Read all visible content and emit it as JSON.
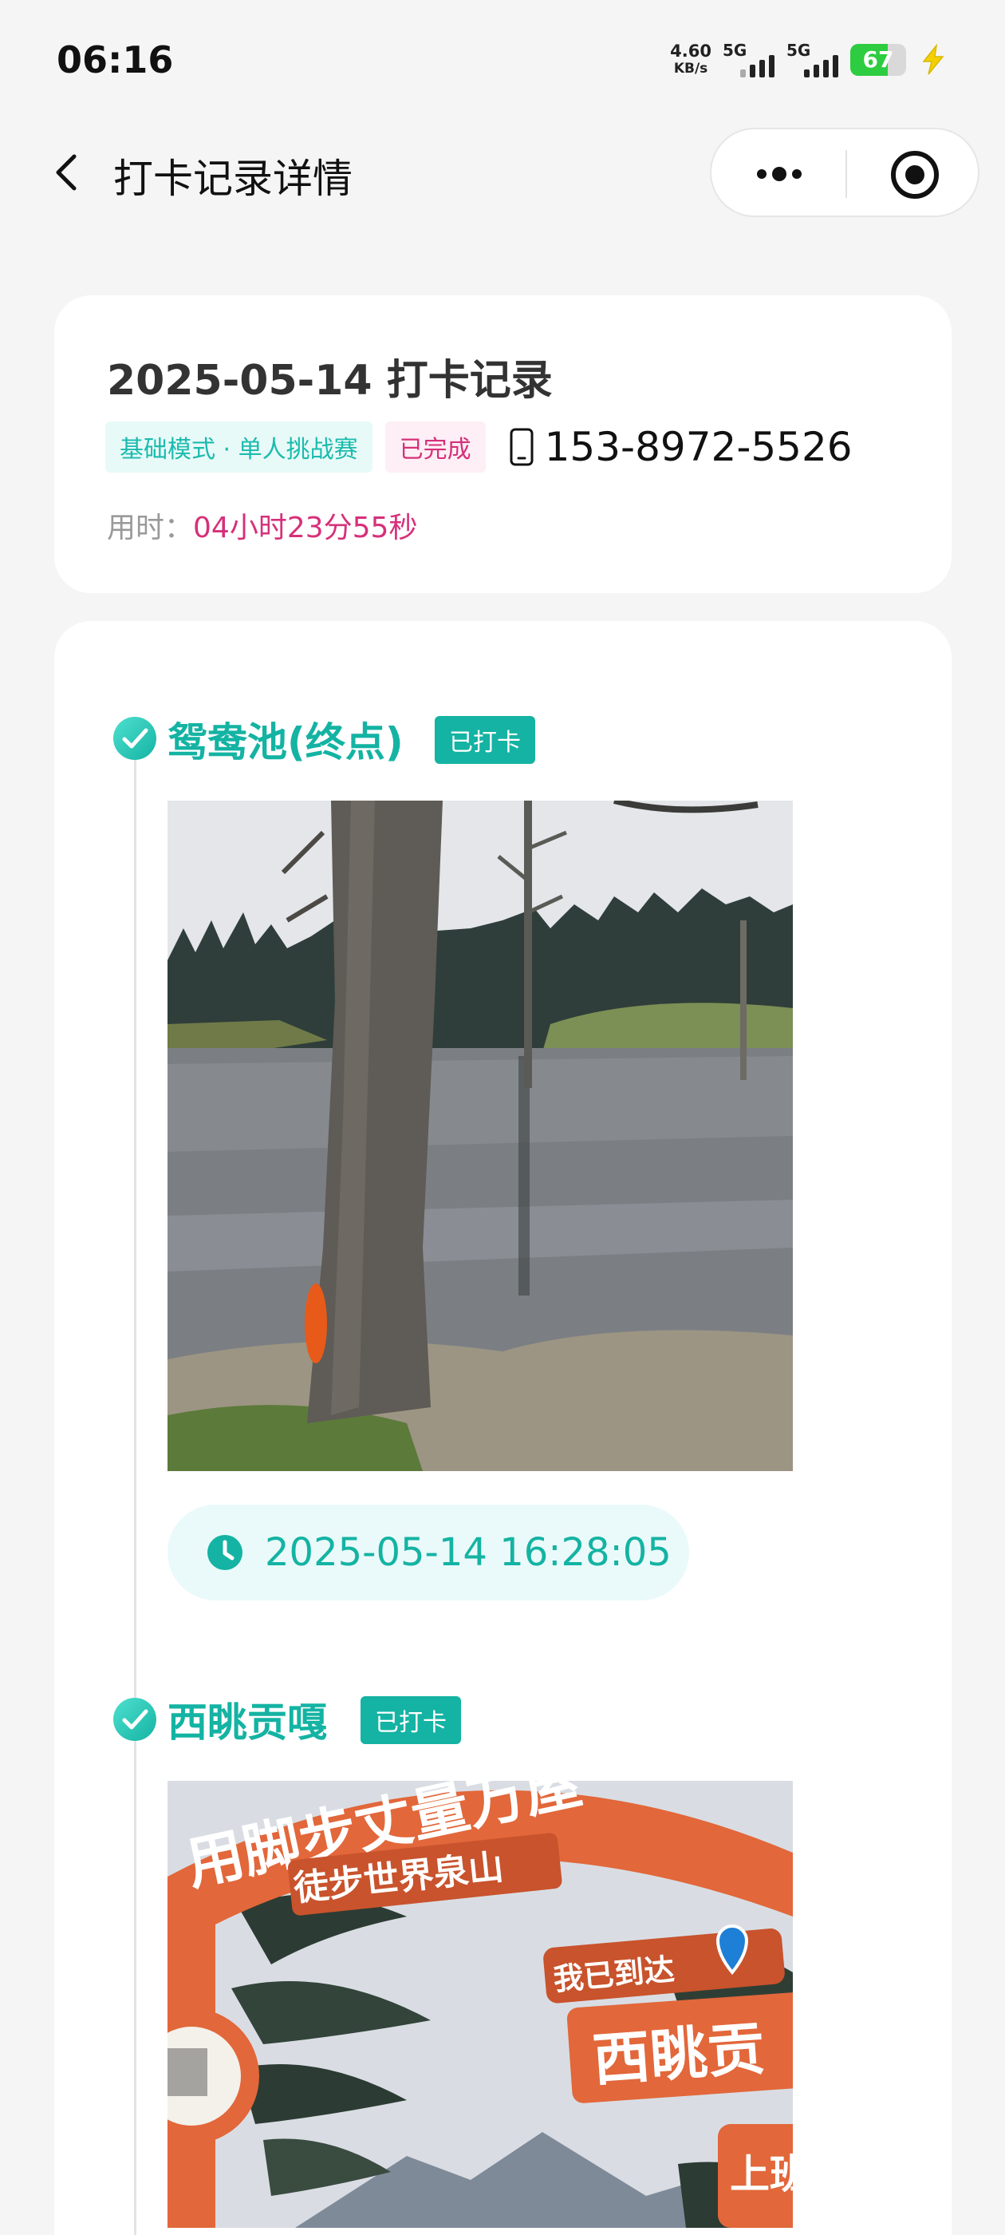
{
  "status_bar": {
    "time": "06:16",
    "net_speed": "4.60",
    "net_unit": "KB/s",
    "signal1_label": "5G",
    "signal2_label": "5G",
    "battery": "67",
    "battery_level": 0.67,
    "battery_color": "#2ecc40"
  },
  "nav": {
    "title": "打卡记录详情",
    "back_icon": "chevron-left-icon",
    "more_icon": "more-dots-icon",
    "close_icon": "target-icon"
  },
  "summary": {
    "title": "2025-05-14 打卡记录",
    "mode_tag": "基础模式 · 单人挑战赛",
    "status_tag": "已完成",
    "phone": "153-8972-5526",
    "duration_label": "用时：",
    "duration_value": "04小时23分55秒"
  },
  "checkpoints": [
    {
      "name": "鸳鸯池(终点)",
      "badge": "已打卡",
      "time": "2025-05-14 16:28:05"
    },
    {
      "name": "西眺贡嘎",
      "badge": "已打卡",
      "photo_text_top": "用脚步丈量万屋",
      "photo_text_sub": "徒步世界泉山",
      "photo_sign1": "我已到达",
      "photo_sign2": "西眺贡",
      "photo_sign3": "上班"
    }
  ],
  "colors": {
    "accent": "#14b3a3",
    "accent_bg": "#eafafa",
    "status_pink": "#d6307a",
    "background": "#f5f5f5"
  }
}
